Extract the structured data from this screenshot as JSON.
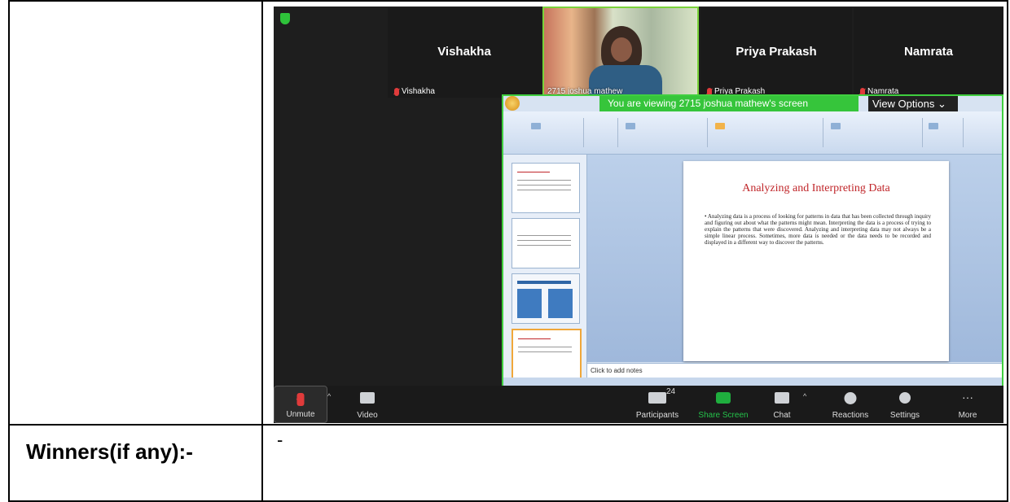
{
  "document": {
    "winners_label": "Winners(if any):-",
    "winners_value": "-"
  },
  "zoom": {
    "participants_tiles": [
      {
        "name": "Vishakha",
        "tag": "Vishakha"
      },
      {
        "name": "Priya Prakash",
        "tag": "Priya Prakash"
      },
      {
        "name": "Namrata",
        "tag": "Namrata"
      }
    ],
    "active_video_tag": "2715 joshua mathew",
    "banner": "You are viewing 2715 joshua mathew's screen",
    "view_options": "View Options ⌄",
    "slide": {
      "title": "Analyzing and Interpreting Data",
      "body": "• Analyzing data is a process of looking for patterns in data that has been collected through inquiry and figuring out about what the patterns might mean. Interpreting the data is a process of trying to explain the patterns that were discovered. Analyzing and interpreting data may not always be a simple linear process. Sometimes, more data is needed or the data needs to be recorded and displayed in a different way to discover the patterns.",
      "notes_placeholder": "Click to add notes"
    },
    "toolbar": {
      "unmute": "Unmute",
      "video": "Video",
      "participants": "Participants",
      "participants_count": "24",
      "share_screen": "Share Screen",
      "chat": "Chat",
      "reactions": "Reactions",
      "settings": "Settings",
      "more": "More"
    },
    "colors": {
      "green": "#36c53b",
      "muted_red": "#e03b3b"
    }
  }
}
